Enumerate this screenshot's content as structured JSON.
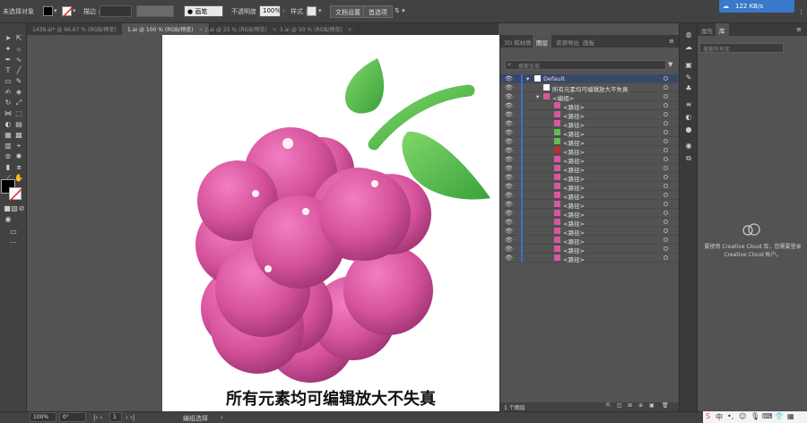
{
  "control_bar": {
    "selection_label": "未选择对象",
    "stroke_label": "描边 :",
    "brush_label": "● 画笔",
    "opacity_label": "不透明度 :",
    "opacity_value": "100%",
    "style_label": "样式 :",
    "doc_settings": "文档设置",
    "preferences": "首选项",
    "cloud_status": "122 KB/s"
  },
  "doc_tabs": [
    {
      "label": "1439.ai* @ 66.67 % (RGB/预览)",
      "close": "×"
    },
    {
      "label": "1.ai @ 100 % (RGB/预览)",
      "close": "×"
    },
    {
      "label": "2.ai @ 25 % (RGB/预览)",
      "close": "×"
    },
    {
      "label": "3.ai @ 50 % (RGB/预览)",
      "close": "×"
    }
  ],
  "artboard": {
    "caption": "所有元素均可编辑放大不失真"
  },
  "layers_panel": {
    "tabs": [
      "3D 和材质",
      "图层",
      "资源导出",
      "画板"
    ],
    "search_placeholder": "搜索全部",
    "layer_default": "Default",
    "rows": [
      {
        "name": "所有元素均可编辑放大不失真",
        "thumb": "text"
      },
      {
        "name": "<编组>",
        "thumb": "group"
      },
      {
        "name": "<路径>",
        "thumb": "pink"
      },
      {
        "name": "<路径>",
        "thumb": "pink"
      },
      {
        "name": "<路径>",
        "thumb": "pink"
      },
      {
        "name": "<路径>",
        "thumb": "green"
      },
      {
        "name": "<路径>",
        "thumb": "green"
      },
      {
        "name": "<路径>",
        "thumb": "stripe"
      },
      {
        "name": "<路径>",
        "thumb": "pink"
      },
      {
        "name": "<路径>",
        "thumb": "pink"
      },
      {
        "name": "<路径>",
        "thumb": "pink"
      },
      {
        "name": "<路径>",
        "thumb": "pink"
      },
      {
        "name": "<路径>",
        "thumb": "pink"
      },
      {
        "name": "<路径>",
        "thumb": "pink"
      },
      {
        "name": "<路径>",
        "thumb": "pink"
      },
      {
        "name": "<路径>",
        "thumb": "pink"
      },
      {
        "name": "<路径>",
        "thumb": "pink"
      },
      {
        "name": "<路径>",
        "thumb": "pink"
      },
      {
        "name": "<路径>",
        "thumb": "pink"
      },
      {
        "name": "<路径>",
        "thumb": "pink"
      }
    ],
    "footer": "1 个图层"
  },
  "libraries_panel": {
    "tabs": [
      "属性",
      "库"
    ],
    "search_placeholder": "搜索所有库",
    "message": "要使用 Creative Cloud 库，您需要登录 Creative Cloud 帐户。"
  },
  "status_bar": {
    "zoom": "100%",
    "angle": "0°",
    "page": "1",
    "tool_mode": "编组选择"
  },
  "colors": {
    "accent": "#3d6ad6",
    "grape": "#d9589e",
    "leaf": "#5cbf4e"
  }
}
